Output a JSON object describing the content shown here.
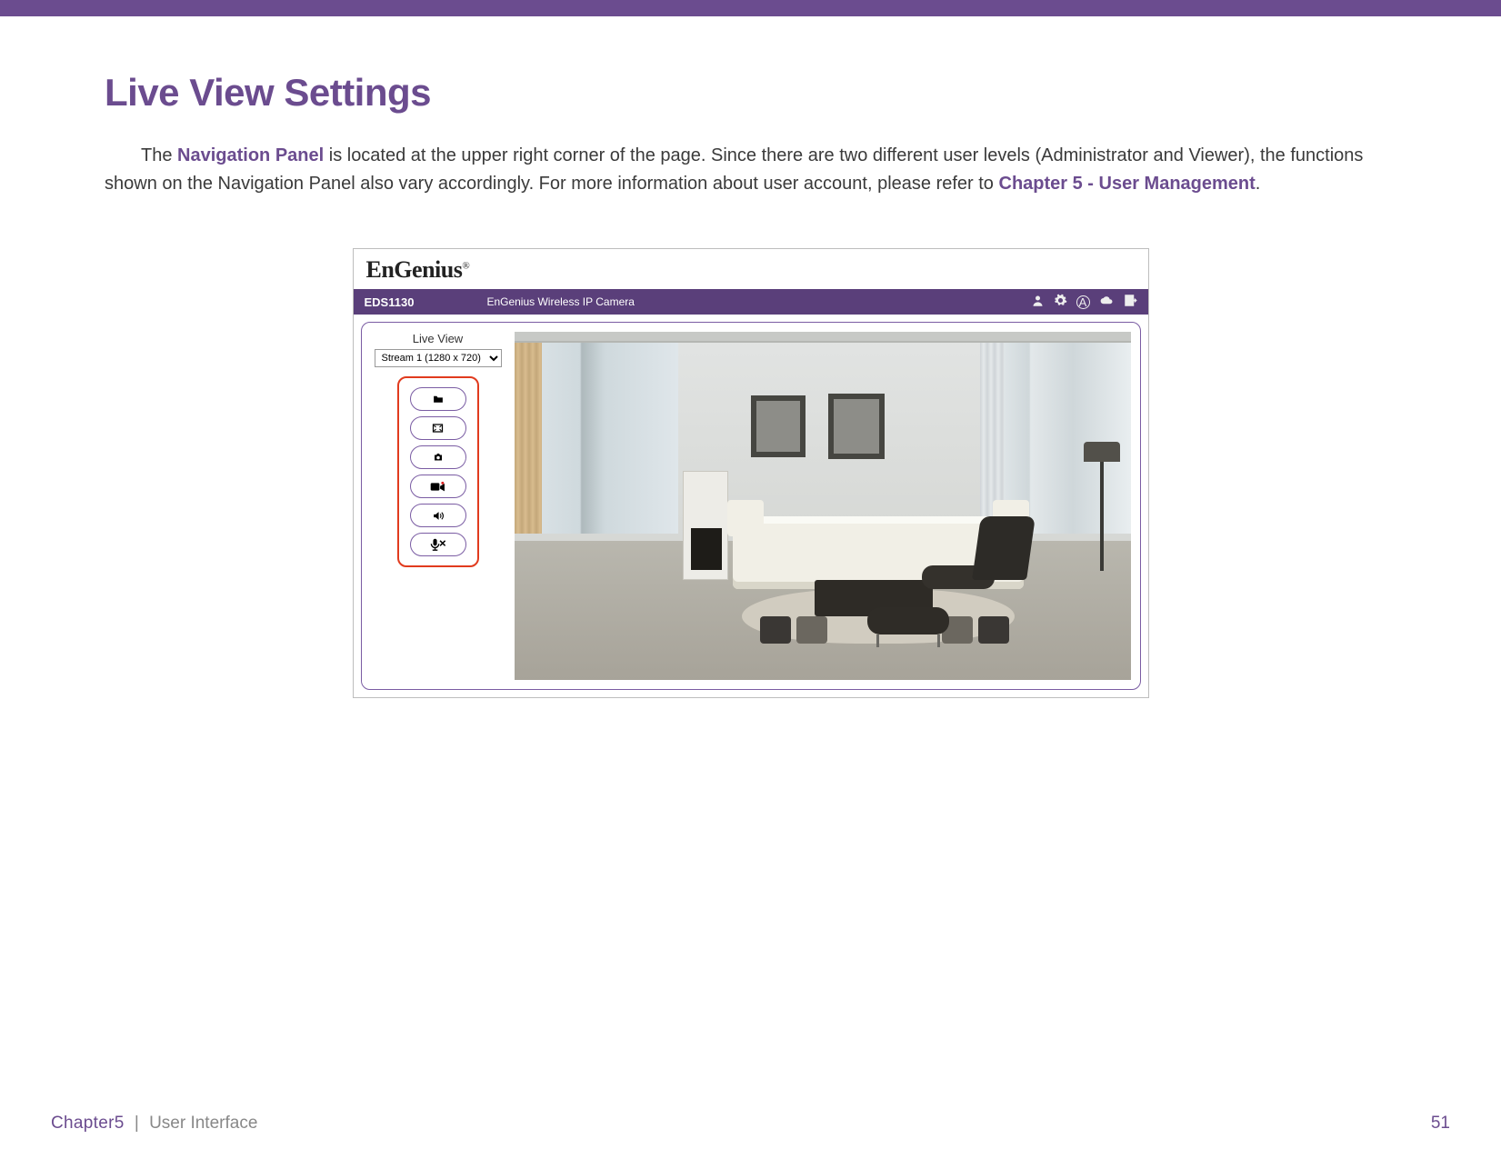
{
  "page": {
    "title": "Live View Settings",
    "para_a": "The ",
    "nav_panel": "Navigation Panel",
    "para_b": " is located at the upper right corner of the page. Since there are two different user levels (Administrator and Viewer), the functions shown on the Navigation Panel also vary accordingly. For more information about user account, please refer to ",
    "chapter_link": "Chapter 5 - User Management",
    "para_c": "."
  },
  "screenshot": {
    "logo": "EnGenius",
    "logo_reg": "®",
    "model": "EDS1130",
    "product_name": "EnGenius Wireless IP Camera",
    "nav_icons": [
      "user-icon",
      "gear-icon",
      "circle-a-icon",
      "cloud-icon",
      "logout-icon"
    ],
    "live_view_label": "Live View",
    "stream_option": "Stream 1 (1280 x 720)",
    "control_buttons": [
      "folder-icon",
      "fullscreen-icon",
      "camera-icon",
      "record-icon",
      "speaker-icon",
      "mic-mute-icon"
    ]
  },
  "footer": {
    "chapter": "Chapter5",
    "section": "User Interface",
    "page_number": "51"
  }
}
